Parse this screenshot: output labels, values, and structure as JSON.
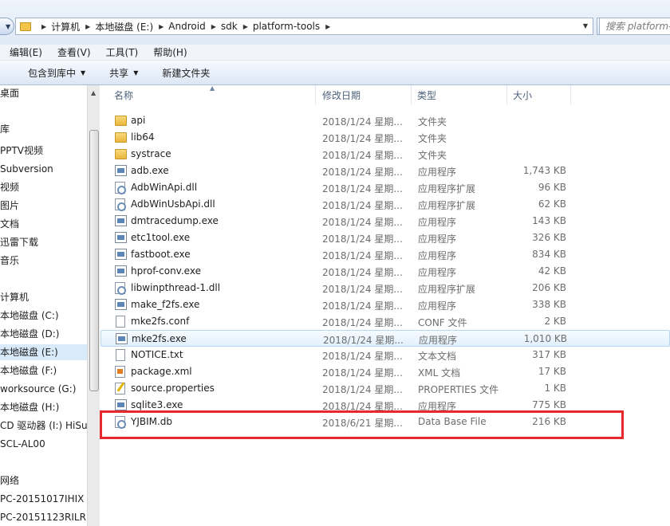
{
  "address_bar": {
    "crumbs": [
      "计算机",
      "本地磁盘 (E:)",
      "Android",
      "sdk",
      "platform-tools"
    ],
    "search_placeholder": "搜索 platform-tools"
  },
  "menu": [
    "编辑(E)",
    "查看(V)",
    "工具(T)",
    "帮助(H)"
  ],
  "toolbar": {
    "include_library": "包含到库中",
    "share": "共享",
    "new_folder": "新建文件夹"
  },
  "nav_pane": {
    "items": [
      {
        "label": "桌面",
        "selected": false
      },
      {
        "label": "库",
        "selected": false
      },
      {
        "label": "PPTV视频",
        "selected": false
      },
      {
        "label": "Subversion",
        "selected": false
      },
      {
        "label": "视频",
        "selected": false
      },
      {
        "label": "图片",
        "selected": false
      },
      {
        "label": "文档",
        "selected": false
      },
      {
        "label": "迅雷下载",
        "selected": false
      },
      {
        "label": "音乐",
        "selected": false
      },
      {
        "label": "计算机",
        "selected": false
      },
      {
        "label": "本地磁盘 (C:)",
        "selected": false
      },
      {
        "label": "本地磁盘 (D:)",
        "selected": false
      },
      {
        "label": "本地磁盘 (E:)",
        "selected": true
      },
      {
        "label": "本地磁盘 (F:)",
        "selected": false
      },
      {
        "label": "worksource (G:)",
        "selected": false
      },
      {
        "label": "本地磁盘 (H:)",
        "selected": false
      },
      {
        "label": "CD 驱动器 (I:) HiSu",
        "selected": false
      },
      {
        "label": "SCL-AL00",
        "selected": false
      },
      {
        "label": "网络",
        "selected": false
      },
      {
        "label": "PC-20151017IHIX",
        "selected": false
      },
      {
        "label": "PC-20151123RILR",
        "selected": false
      }
    ]
  },
  "columns": {
    "name": "名称",
    "date": "修改日期",
    "type": "类型",
    "size": "大小"
  },
  "files": [
    {
      "name": "api",
      "date": "2018/1/24 星期...",
      "type": "文件夹",
      "size": "",
      "icon": "folder-icon"
    },
    {
      "name": "lib64",
      "date": "2018/1/24 星期...",
      "type": "文件夹",
      "size": "",
      "icon": "folder-icon"
    },
    {
      "name": "systrace",
      "date": "2018/1/24 星期...",
      "type": "文件夹",
      "size": "",
      "icon": "folder-icon"
    },
    {
      "name": "adb.exe",
      "date": "2018/1/24 星期...",
      "type": "应用程序",
      "size": "1,743 KB",
      "icon": "exe-icon"
    },
    {
      "name": "AdbWinApi.dll",
      "date": "2018/1/24 星期...",
      "type": "应用程序扩展",
      "size": "96 KB",
      "icon": "dll-icon"
    },
    {
      "name": "AdbWinUsbApi.dll",
      "date": "2018/1/24 星期...",
      "type": "应用程序扩展",
      "size": "62 KB",
      "icon": "dll-icon"
    },
    {
      "name": "dmtracedump.exe",
      "date": "2018/1/24 星期...",
      "type": "应用程序",
      "size": "143 KB",
      "icon": "exe-icon"
    },
    {
      "name": "etc1tool.exe",
      "date": "2018/1/24 星期...",
      "type": "应用程序",
      "size": "326 KB",
      "icon": "exe-icon"
    },
    {
      "name": "fastboot.exe",
      "date": "2018/1/24 星期...",
      "type": "应用程序",
      "size": "834 KB",
      "icon": "exe-icon"
    },
    {
      "name": "hprof-conv.exe",
      "date": "2018/1/24 星期...",
      "type": "应用程序",
      "size": "42 KB",
      "icon": "exe-icon"
    },
    {
      "name": "libwinpthread-1.dll",
      "date": "2018/1/24 星期...",
      "type": "应用程序扩展",
      "size": "206 KB",
      "icon": "dll-icon"
    },
    {
      "name": "make_f2fs.exe",
      "date": "2018/1/24 星期...",
      "type": "应用程序",
      "size": "338 KB",
      "icon": "exe-icon"
    },
    {
      "name": "mke2fs.conf",
      "date": "2018/1/24 星期...",
      "type": "CONF 文件",
      "size": "2 KB",
      "icon": "doc-icon"
    },
    {
      "name": "mke2fs.exe",
      "date": "2018/1/24 星期...",
      "type": "应用程序",
      "size": "1,010 KB",
      "icon": "exe-icon",
      "selected": true
    },
    {
      "name": "NOTICE.txt",
      "date": "2018/1/24 星期...",
      "type": "文本文档",
      "size": "317 KB",
      "icon": "doc-icon"
    },
    {
      "name": "package.xml",
      "date": "2018/1/24 星期...",
      "type": "XML 文档",
      "size": "17 KB",
      "icon": "xml-icon"
    },
    {
      "name": "source.properties",
      "date": "2018/1/24 星期...",
      "type": "PROPERTIES 文件",
      "size": "1 KB",
      "icon": "properties-icon"
    },
    {
      "name": "sqlite3.exe",
      "date": "2018/1/24 星期...",
      "type": "应用程序",
      "size": "775 KB",
      "icon": "exe-icon"
    },
    {
      "name": "YJBIM.db",
      "date": "2018/6/21 星期...",
      "type": "Data Base File",
      "size": "216 KB",
      "icon": "dll-icon"
    }
  ],
  "highlight_color": "#e8292b",
  "selection_color": "#d9ebfa"
}
